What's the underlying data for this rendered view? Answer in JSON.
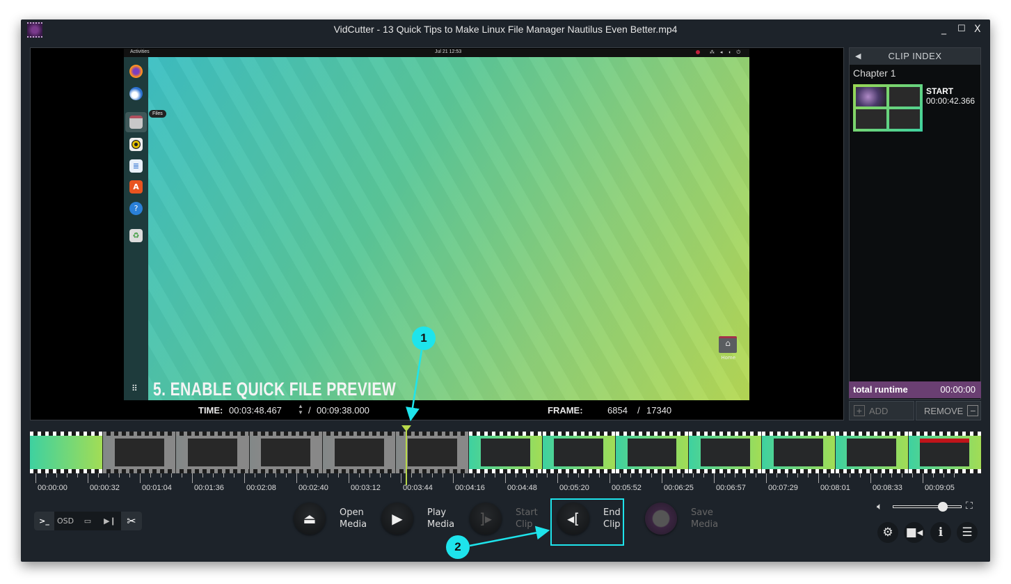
{
  "window": {
    "title": "VidCutter - 13 Quick Tips to Make Linux File Manager Nautilus Even Better.mp4",
    "controls": {
      "minimize": "_",
      "maximize": "☐",
      "close": "X"
    }
  },
  "video": {
    "desktop": {
      "activities": "Activities",
      "clock": "Jul 21  12:53",
      "dock_tooltip": "Files",
      "dock_apps": [
        "Firefox",
        "Thunderbird",
        "Files",
        "Rhythmbox",
        "LibreOffice Writer",
        "Ubuntu Software",
        "Help",
        "Trash"
      ],
      "desktop_icon_label": "Home"
    },
    "caption": "5. ENABLE QUICK FILE PREVIEW"
  },
  "time_display": {
    "time_label": "TIME:",
    "current_time": "00:03:48.467",
    "separator": "/",
    "total_time": "00:09:38.000",
    "frame_label": "FRAME:",
    "current_frame": "6854",
    "frame_separator": "/",
    "total_frames": "17340"
  },
  "clip_index": {
    "header": "CLIP INDEX",
    "collapse_icon": "◀",
    "chapter": "Chapter 1",
    "clips": [
      {
        "label": "START",
        "time": "00:00:42.366"
      }
    ],
    "total_runtime_label": "total runtime",
    "total_runtime_value": "00:00:00",
    "add_label": "ADD",
    "remove_label": "REMOVE"
  },
  "timeline": {
    "duration_seconds": 578,
    "position_seconds": 228.467,
    "tick_labels": [
      "00:00:00",
      "00:00:32",
      "00:01:04",
      "00:01:36",
      "00:02:08",
      "00:02:40",
      "00:03:12",
      "00:03:44",
      "00:04:16",
      "00:04:48",
      "00:05:20",
      "00:05:52",
      "00:06:25",
      "00:06:57",
      "00:07:29",
      "00:08:01",
      "00:08:33",
      "00:09:05"
    ],
    "thumbnail_count": 13,
    "dimmed_range": [
      1,
      5
    ]
  },
  "toolbar": {
    "console_label": ">_",
    "osd_label": "OSD",
    "open_label": "Open\nMedia",
    "open_line1": "Open",
    "open_line2": "Media",
    "play_line1": "Play",
    "play_line2": "Media",
    "start_line1": "Start",
    "start_line2": "Clip",
    "end_line1": "End",
    "end_line2": "Clip",
    "save_line1": "Save",
    "save_line2": "Media"
  },
  "volume": {
    "level": 0.72
  },
  "annotations": [
    {
      "number": "1"
    },
    {
      "number": "2"
    }
  ],
  "colors": {
    "accent_callout": "#1ee4ec",
    "playhead": "#b9d94a",
    "runtime_bar": "#6a3f72",
    "window_bg": "#1d232a"
  }
}
